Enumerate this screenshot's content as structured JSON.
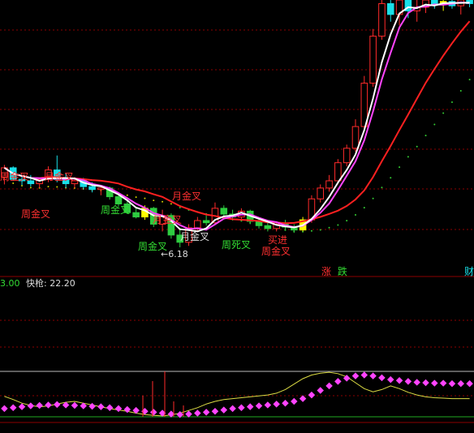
{
  "colors": {
    "background": "#000000",
    "grid": "#8b0000",
    "up_candle": "#ff2a2a",
    "down_candle": "#19e0e8",
    "green_candle": "#2ecc40",
    "highlight_candle": "#ffff00",
    "ma_white": "#ffffff",
    "ma_magenta": "#ff44ff",
    "ma_red": "#ff2020",
    "dots_green": "#33cc33",
    "dots_yellow": "#cccc00",
    "text_red": "#ff3030",
    "text_green": "#33dd33",
    "text_white": "#dddddd",
    "sub_yellow_line": "#dddd44",
    "sub_magenta_dots": "#ff44ff",
    "sub_green_line": "#22aa22"
  },
  "main_panel": {
    "annotations": [
      {
        "key": "a1",
        "text": "周金叉",
        "color": "red"
      },
      {
        "key": "a2",
        "text": "月金叉",
        "color": "red"
      },
      {
        "key": "a3",
        "text": "周金叉",
        "color": "red"
      },
      {
        "key": "a4",
        "text": "月金叉",
        "color": "red"
      },
      {
        "key": "a5",
        "text": "周金叉",
        "color": "green"
      },
      {
        "key": "a6",
        "text": "月金叉",
        "color": "white"
      },
      {
        "key": "a7",
        "text": "月金叉",
        "color": "red"
      },
      {
        "key": "a8",
        "text": "周死叉",
        "color": "green"
      },
      {
        "key": "a9",
        "text": "买进",
        "color": "red"
      },
      {
        "key": "a10",
        "text": "周金叉",
        "color": "red"
      },
      {
        "key": "a11",
        "text": "周金叉",
        "color": "green"
      }
    ],
    "low_marker": "←6.18",
    "bottom_badges": [
      {
        "text": "涨",
        "color": "red"
      },
      {
        "text": "跌",
        "color": "green"
      },
      {
        "text": "财",
        "color": "cyan"
      }
    ]
  },
  "sub_panel": {
    "left_value": "3.00",
    "indicator_label": "快枪:",
    "indicator_value": "22.20"
  },
  "chart_data": {
    "type": "candlestick",
    "y_range": [
      5.9,
      9.6
    ],
    "candles": [
      {
        "o": 7.15,
        "h": 7.32,
        "l": 7.05,
        "c": 7.28,
        "d": "up"
      },
      {
        "o": 7.28,
        "h": 7.3,
        "l": 7.1,
        "c": 7.12,
        "d": "down"
      },
      {
        "o": 7.12,
        "h": 7.16,
        "l": 7.04,
        "c": 7.1,
        "d": "down"
      },
      {
        "o": 7.1,
        "h": 7.18,
        "l": 7.02,
        "c": 7.06,
        "d": "down"
      },
      {
        "o": 7.06,
        "h": 7.14,
        "l": 7.0,
        "c": 7.12,
        "d": "up"
      },
      {
        "o": 7.12,
        "h": 7.3,
        "l": 7.08,
        "c": 7.25,
        "d": "up"
      },
      {
        "o": 7.25,
        "h": 7.45,
        "l": 7.08,
        "c": 7.12,
        "d": "down"
      },
      {
        "o": 7.12,
        "h": 7.2,
        "l": 7.0,
        "c": 7.06,
        "d": "down"
      },
      {
        "o": 7.06,
        "h": 7.15,
        "l": 7.0,
        "c": 7.1,
        "d": "up"
      },
      {
        "o": 7.1,
        "h": 7.14,
        "l": 6.98,
        "c": 7.02,
        "d": "down"
      },
      {
        "o": 7.02,
        "h": 7.08,
        "l": 6.94,
        "c": 6.98,
        "d": "down"
      },
      {
        "o": 6.98,
        "h": 7.04,
        "l": 6.9,
        "c": 7.0,
        "d": "up"
      },
      {
        "o": 7.0,
        "h": 7.02,
        "l": 6.84,
        "c": 6.88,
        "d": "green"
      },
      {
        "o": 6.88,
        "h": 6.92,
        "l": 6.74,
        "c": 6.78,
        "d": "green"
      },
      {
        "o": 6.78,
        "h": 6.82,
        "l": 6.64,
        "c": 6.66,
        "d": "green"
      },
      {
        "o": 6.66,
        "h": 6.72,
        "l": 6.58,
        "c": 6.6,
        "d": "green"
      },
      {
        "o": 6.6,
        "h": 6.76,
        "l": 6.56,
        "c": 6.72,
        "d": "yellow"
      },
      {
        "o": 6.72,
        "h": 6.74,
        "l": 6.46,
        "c": 6.5,
        "d": "green"
      },
      {
        "o": 6.5,
        "h": 6.7,
        "l": 6.4,
        "c": 6.62,
        "d": "up"
      },
      {
        "o": 6.62,
        "h": 6.65,
        "l": 6.3,
        "c": 6.35,
        "d": "green"
      },
      {
        "o": 6.35,
        "h": 6.45,
        "l": 6.18,
        "c": 6.25,
        "d": "green"
      },
      {
        "o": 6.25,
        "h": 6.5,
        "l": 6.2,
        "c": 6.45,
        "d": "up"
      },
      {
        "o": 6.45,
        "h": 6.6,
        "l": 6.4,
        "c": 6.55,
        "d": "up"
      },
      {
        "o": 6.55,
        "h": 6.62,
        "l": 6.48,
        "c": 6.52,
        "d": "green"
      },
      {
        "o": 6.52,
        "h": 6.8,
        "l": 6.5,
        "c": 6.72,
        "d": "up"
      },
      {
        "o": 6.72,
        "h": 6.76,
        "l": 6.6,
        "c": 6.64,
        "d": "green"
      },
      {
        "o": 6.64,
        "h": 6.7,
        "l": 6.55,
        "c": 6.6,
        "d": "green"
      },
      {
        "o": 6.6,
        "h": 6.72,
        "l": 6.56,
        "c": 6.68,
        "d": "up"
      },
      {
        "o": 6.68,
        "h": 6.7,
        "l": 6.5,
        "c": 6.54,
        "d": "green"
      },
      {
        "o": 6.54,
        "h": 6.58,
        "l": 6.44,
        "c": 6.48,
        "d": "green"
      },
      {
        "o": 6.48,
        "h": 6.52,
        "l": 6.4,
        "c": 6.44,
        "d": "green"
      },
      {
        "o": 6.44,
        "h": 6.54,
        "l": 6.4,
        "c": 6.5,
        "d": "up"
      },
      {
        "o": 6.5,
        "h": 6.56,
        "l": 6.42,
        "c": 6.46,
        "d": "green"
      },
      {
        "o": 6.46,
        "h": 6.5,
        "l": 6.38,
        "c": 6.42,
        "d": "green"
      },
      {
        "o": 6.42,
        "h": 6.6,
        "l": 6.4,
        "c": 6.56,
        "d": "yellow"
      },
      {
        "o": 6.56,
        "h": 6.9,
        "l": 6.52,
        "c": 6.85,
        "d": "up"
      },
      {
        "o": 6.85,
        "h": 7.05,
        "l": 6.8,
        "c": 7.0,
        "d": "up"
      },
      {
        "o": 7.0,
        "h": 7.18,
        "l": 6.95,
        "c": 7.1,
        "d": "up"
      },
      {
        "o": 7.1,
        "h": 7.4,
        "l": 7.05,
        "c": 7.35,
        "d": "up"
      },
      {
        "o": 7.35,
        "h": 7.6,
        "l": 7.3,
        "c": 7.55,
        "d": "up"
      },
      {
        "o": 7.55,
        "h": 7.95,
        "l": 7.5,
        "c": 7.85,
        "d": "up"
      },
      {
        "o": 7.85,
        "h": 8.55,
        "l": 7.8,
        "c": 8.45,
        "d": "up"
      },
      {
        "o": 8.45,
        "h": 9.2,
        "l": 8.4,
        "c": 9.1,
        "d": "up"
      },
      {
        "o": 9.1,
        "h": 9.65,
        "l": 9.05,
        "c": 9.55,
        "d": "up"
      },
      {
        "o": 9.55,
        "h": 9.75,
        "l": 9.3,
        "c": 9.4,
        "d": "down"
      },
      {
        "o": 9.4,
        "h": 9.7,
        "l": 9.25,
        "c": 9.6,
        "d": "up"
      },
      {
        "o": 9.6,
        "h": 9.72,
        "l": 9.35,
        "c": 9.45,
        "d": "down"
      },
      {
        "o": 9.45,
        "h": 9.62,
        "l": 9.3,
        "c": 9.5,
        "d": "up"
      },
      {
        "o": 9.5,
        "h": 9.66,
        "l": 9.42,
        "c": 9.6,
        "d": "up"
      },
      {
        "o": 9.6,
        "h": 9.7,
        "l": 9.48,
        "c": 9.54,
        "d": "down"
      },
      {
        "o": 9.54,
        "h": 9.68,
        "l": 9.45,
        "c": 9.58,
        "d": "yellow"
      },
      {
        "o": 9.58,
        "h": 9.66,
        "l": 9.48,
        "c": 9.52,
        "d": "down"
      },
      {
        "o": 9.52,
        "h": 9.64,
        "l": 9.4,
        "c": 9.6,
        "d": "up"
      },
      {
        "o": 9.6,
        "h": 9.7,
        "l": 9.5,
        "c": 9.55,
        "d": "down"
      }
    ],
    "sub_dots": [
      0.18,
      0.2,
      0.22,
      0.24,
      0.25,
      0.26,
      0.27,
      0.26,
      0.25,
      0.24,
      0.23,
      0.22,
      0.2,
      0.18,
      0.16,
      0.14,
      0.12,
      0.1,
      0.08,
      0.06,
      0.05,
      0.06,
      0.08,
      0.1,
      0.12,
      0.15,
      0.18,
      0.2,
      0.22,
      0.24,
      0.26,
      0.28,
      0.3,
      0.34,
      0.4,
      0.48,
      0.58,
      0.68,
      0.78,
      0.85,
      0.9,
      0.92,
      0.9,
      0.86,
      0.82,
      0.8,
      0.78,
      0.76,
      0.75,
      0.74,
      0.74,
      0.73,
      0.73,
      0.73
    ],
    "sub_line": [
      0.45,
      0.38,
      0.3,
      0.25,
      0.22,
      0.24,
      0.28,
      0.32,
      0.34,
      0.3,
      0.26,
      0.22,
      0.18,
      0.15,
      0.12,
      0.08,
      0.05,
      0.03,
      0.02,
      0.04,
      0.08,
      0.14,
      0.2,
      0.28,
      0.34,
      0.38,
      0.4,
      0.42,
      0.44,
      0.46,
      0.48,
      0.52,
      0.6,
      0.72,
      0.84,
      0.92,
      0.96,
      0.98,
      0.95,
      0.88,
      0.75,
      0.62,
      0.55,
      0.6,
      0.68,
      0.62,
      0.54,
      0.48,
      0.44,
      0.42,
      0.41,
      0.4,
      0.4,
      0.4
    ]
  }
}
